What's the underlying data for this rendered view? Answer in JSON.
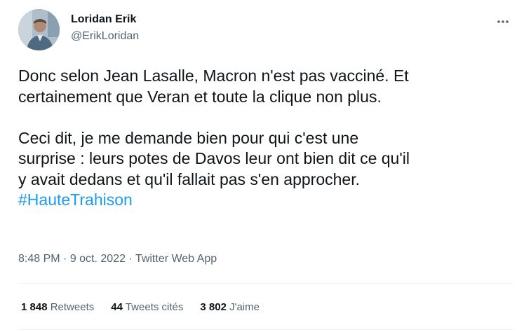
{
  "author": {
    "display_name": "Loridan Erik",
    "handle": "@ErikLoridan"
  },
  "tweet": {
    "paragraph1": "Donc selon Jean Lasalle, Macron n'est pas vacciné. Et\ncertainement que Veran et toute la clique non plus.",
    "paragraph2": "Ceci dit, je me demande bien pour qui c'est une\nsurprise : leurs potes de Davos leur ont bien dit ce qu'il\ny avait dedans et qu'il fallait pas s'en approcher.",
    "hashtag": "#HauteTrahison"
  },
  "meta": {
    "time": "8:48 PM",
    "separator1": " · ",
    "date": "9 oct. 2022",
    "separator2": " · ",
    "source": "Twitter Web App"
  },
  "stats": {
    "retweets_count": "1 848",
    "retweets_label": "Retweets",
    "quotes_count": "44",
    "quotes_label": "Tweets cités",
    "likes_count": "3 802",
    "likes_label": "J'aime"
  },
  "colors": {
    "text": "#0f1419",
    "secondary": "#536471",
    "link": "#1d9bf0",
    "divider": "#eff3f4"
  },
  "icons": {
    "more": "more-horizontal-icon"
  }
}
